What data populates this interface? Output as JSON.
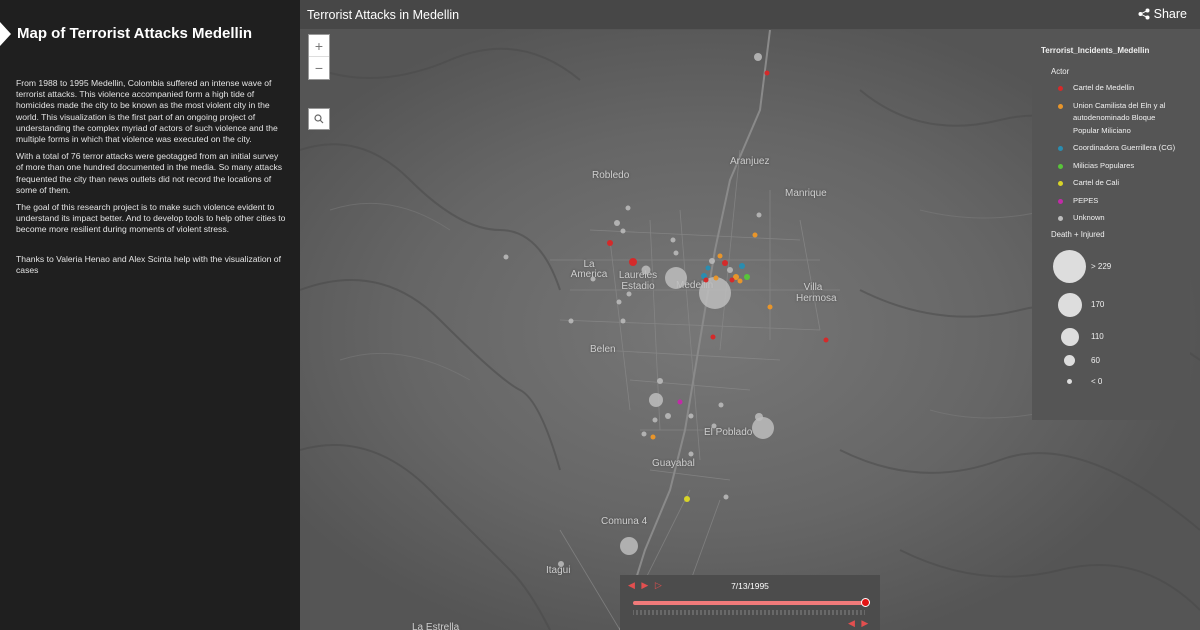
{
  "sidebar": {
    "title": "Map of Terrorist Attacks Medellin",
    "paragraphs": [
      "From 1988 to 1995 Medellin, Colombia suffered an intense wave of terrorist attacks. This violence accompanied form a high tide of homicides made the city to be known as the most violent city in the world. This visualization is the first part of an ongoing project of understanding the complex myriad of actors of such violence and the multiple forms in which that violence was executed on the city.",
      "With a total of 76 terror attacks were geotagged from an initial survey of more than one hundred documented in the media. So many attacks frequented the city than news outlets did not record the locations of some of them.",
      "The goal of this research project is to make such violence evident to understand its impact better. And to develop tools to help other cities to become more resilient during moments of violent stress.",
      "Thanks to Valeria Henao and Alex Scinta help with the visualization of cases"
    ]
  },
  "topbar": {
    "title": "Terrorist Attacks in Medellin",
    "share_label": "Share"
  },
  "map": {
    "zoom_in": "+",
    "zoom_out": "−",
    "places": [
      "Robledo",
      "Aranjuez",
      "Manrique",
      "La America",
      "Laureles Estadio",
      "Medellin",
      "Villa Hermosa",
      "Belen",
      "El Poblado",
      "Guayabal",
      "Comuna 4",
      "Itagui",
      "La Estrella"
    ]
  },
  "legend": {
    "layer_title": "Terrorist_Incidents_Medellin",
    "actor_heading": "Actor",
    "actors": [
      {
        "label": "Cartel de Medellin",
        "color": "#d42a2a"
      },
      {
        "label": "Union Camilista del Eln y al autodenominado Bloque Popular Miliciano",
        "color": "#e8952a"
      },
      {
        "label": "Coordinadora Guerrillera (CG)",
        "color": "#2a8db0"
      },
      {
        "label": "Milicias Populares",
        "color": "#58c43a"
      },
      {
        "label": "Cartel de Cali",
        "color": "#d8d428"
      },
      {
        "label": "PEPES",
        "color": "#c22aa8"
      },
      {
        "label": "Unknown",
        "color": "#bdbdbd"
      }
    ],
    "size_heading": "Death + Injured",
    "sizes": [
      "> 229",
      "170",
      "110",
      "60",
      "< 0"
    ]
  },
  "timeline": {
    "date": "7/13/1995",
    "progress": 1.0
  }
}
